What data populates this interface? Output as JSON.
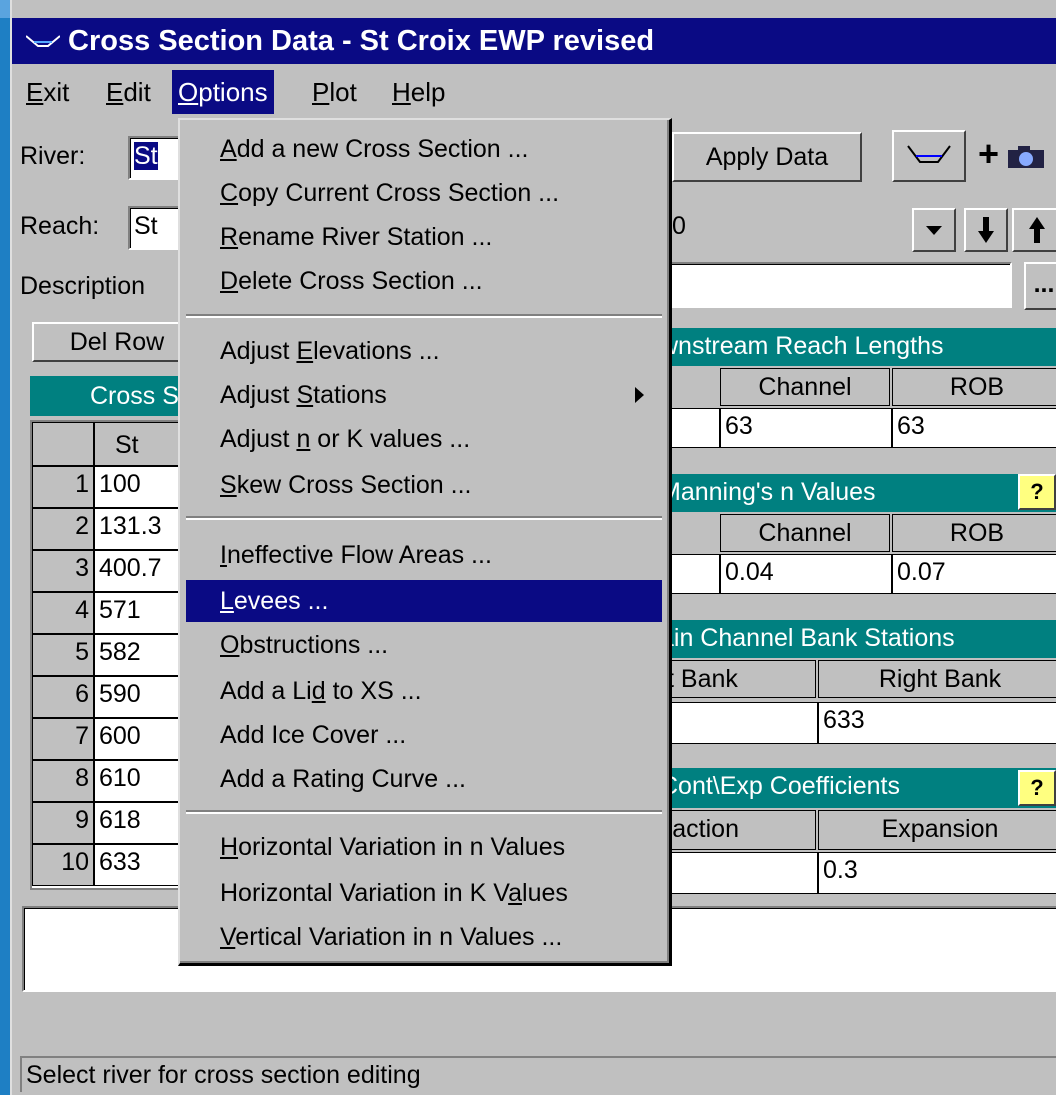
{
  "window": {
    "title": "Cross Section Data - St Croix EWP revised"
  },
  "menubar": {
    "items": [
      {
        "label": "Exit",
        "active": false
      },
      {
        "label": "Edit",
        "active": false
      },
      {
        "label": "Options",
        "active": true
      },
      {
        "label": "Plot",
        "active": false
      },
      {
        "label": "Help",
        "active": false
      }
    ]
  },
  "form": {
    "river_label": "River:",
    "river_value": "St",
    "reach_label": "Reach:",
    "reach_value": "St",
    "station_value": "0",
    "description_label": "Description",
    "apply_data_label": "Apply Data",
    "del_row_label": "Del Row",
    "ellipsis": "..."
  },
  "xs_table": {
    "title": "Cross S",
    "col_header": "St",
    "rows": [
      {
        "num": "1",
        "station": "100"
      },
      {
        "num": "2",
        "station": "131.3"
      },
      {
        "num": "3",
        "station": "400.7"
      },
      {
        "num": "4",
        "station": "571"
      },
      {
        "num": "5",
        "station": "582"
      },
      {
        "num": "6",
        "station": "590"
      },
      {
        "num": "7",
        "station": "600"
      },
      {
        "num": "8",
        "station": "610"
      },
      {
        "num": "9",
        "station": "618"
      },
      {
        "num": "10",
        "station": "633"
      }
    ]
  },
  "reach_lengths": {
    "title": "wnstream Reach Lengths",
    "col_channel": "Channel",
    "col_rob": "ROB",
    "channel_value": "63",
    "rob_value": "63"
  },
  "mannings": {
    "title": "Manning's n Values",
    "col_channel": "Channel",
    "col_rob": "ROB",
    "channel_value": "0.04",
    "rob_value": "0.07"
  },
  "bank_stations": {
    "title": "ain Channel Bank Stations",
    "col_left": "t Bank",
    "col_right": "Right Bank",
    "right_value": "633"
  },
  "coefficients": {
    "title": "Cont\\Exp  Coefficients",
    "col_contraction": "traction",
    "col_expansion": "Expansion",
    "expansion_value": "0.3"
  },
  "options_menu": {
    "items": [
      {
        "label": "Add a new Cross Section ...",
        "ul": 0
      },
      {
        "label": "Copy Current Cross Section ...",
        "ul": 0
      },
      {
        "label": "Rename River Station ...",
        "ul": 0
      },
      {
        "label": "Delete Cross Section ...",
        "ul": 0
      },
      {
        "label": "Adjust Elevations ...",
        "ul": 7
      },
      {
        "label": "Adjust Stations",
        "ul": 7
      },
      {
        "label": "Adjust n or K values ...",
        "ul": 7
      },
      {
        "label": "Skew Cross Section ...",
        "ul": 0
      },
      {
        "label": "Ineffective Flow Areas ...",
        "ul": 0
      },
      {
        "label": "Levees ...",
        "ul": 0
      },
      {
        "label": "Obstructions ...",
        "ul": 0
      },
      {
        "label": "Add a Lid to XS ...",
        "ul": 8
      },
      {
        "label": "Add Ice Cover ...",
        "ul": -1
      },
      {
        "label": "Add a Rating Curve ...",
        "ul": -1
      },
      {
        "label": "Horizontal Variation in n Values",
        "ul": 0
      },
      {
        "label": "Horizontal Variation in K Values",
        "ul": 27
      },
      {
        "label": "Vertical Variation in n Values ...",
        "ul": 0
      }
    ],
    "highlighted": "Levees ..."
  },
  "status": {
    "text": "Select river for cross section editing"
  },
  "colors": {
    "title_bar": "#0a0a84",
    "panel_header": "#008080",
    "menu_highlight": "#0a0a84"
  }
}
